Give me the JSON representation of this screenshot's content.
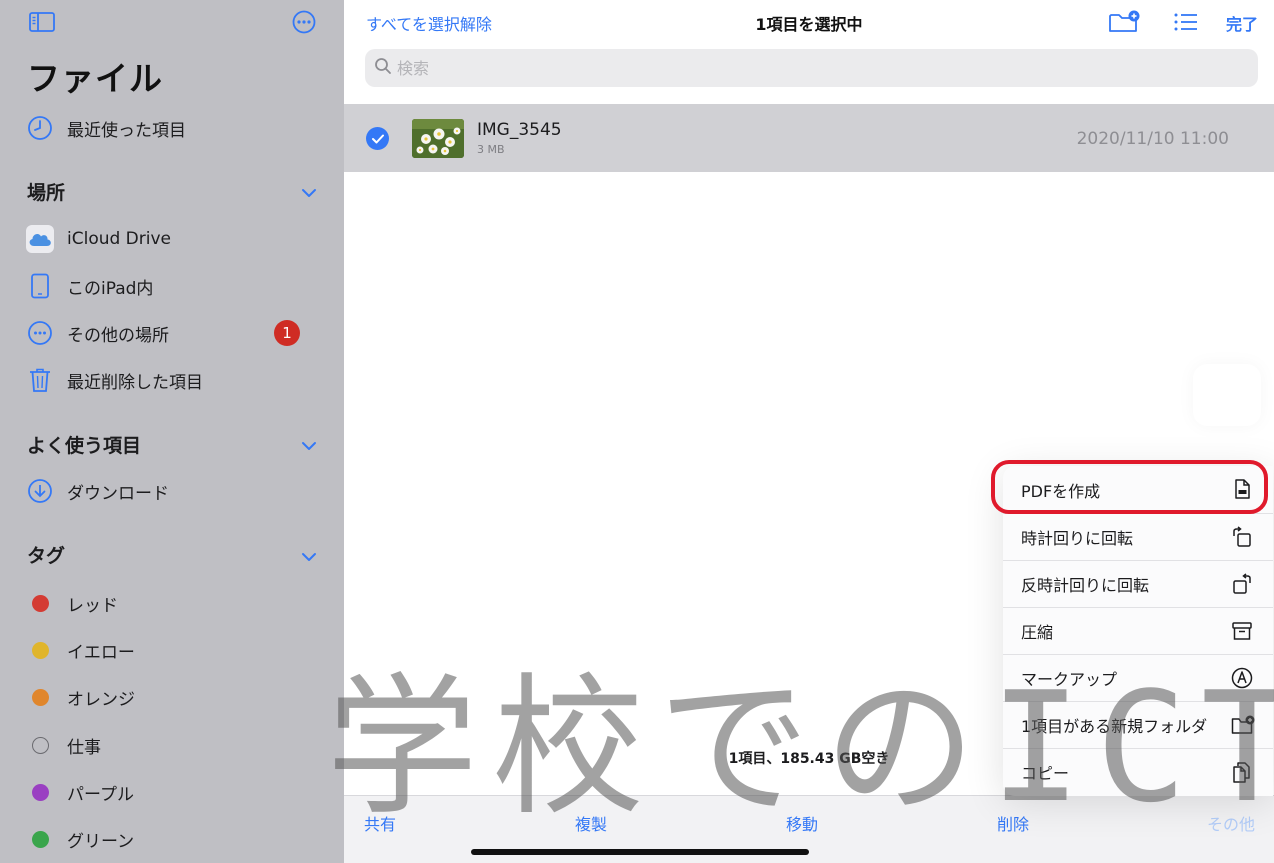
{
  "sidebar": {
    "title": "ファイル",
    "recents": "最近使った項目",
    "locations_header": "場所",
    "locations": [
      {
        "label": "iCloud Drive",
        "icon": "icloud-icon"
      },
      {
        "label": "このiPad内",
        "icon": "ipad-icon"
      },
      {
        "label": "その他の場所",
        "icon": "more-icon",
        "badge": "1"
      },
      {
        "label": "最近削除した項目",
        "icon": "trash-icon"
      }
    ],
    "favorites_header": "よく使う項目",
    "favorites": [
      {
        "label": "ダウンロード",
        "icon": "download-icon"
      }
    ],
    "tags_header": "タグ",
    "tags": [
      {
        "label": "レッド",
        "color": "#d43b33"
      },
      {
        "label": "イエロー",
        "color": "#e0b52c"
      },
      {
        "label": "オレンジ",
        "color": "#e0862c"
      },
      {
        "label": "仕事",
        "color": "none"
      },
      {
        "label": "パープル",
        "color": "#9a3fc2"
      },
      {
        "label": "グリーン",
        "color": "#3aa54c"
      }
    ]
  },
  "header": {
    "deselect_all": "すべてを選択解除",
    "title": "1項目を選択中",
    "done": "完了"
  },
  "search": {
    "placeholder": "検索"
  },
  "file": {
    "name": "IMG_3545",
    "size": "3 MB",
    "date": "2020/11/10 11:00"
  },
  "status": "1項目、185.43 GB空き",
  "toolbar": {
    "share": "共有",
    "duplicate": "複製",
    "move": "移動",
    "delete": "削除",
    "more": "その他"
  },
  "menu": [
    {
      "label": "PDFを作成",
      "icon": "pdf-document-icon"
    },
    {
      "label": "時計回りに回転",
      "icon": "rotate-clockwise-icon"
    },
    {
      "label": "反時計回りに回転",
      "icon": "rotate-counterclockwise-icon"
    },
    {
      "label": "圧縮",
      "icon": "archive-box-icon"
    },
    {
      "label": "マークアップ",
      "icon": "markup-pen-icon"
    },
    {
      "label": "1項目がある新規フォルダ",
      "icon": "new-folder-icon"
    },
    {
      "label": "コピー",
      "icon": "copy-icon"
    }
  ],
  "watermark": "学校でのICT",
  "colors": {
    "accent": "#3478f6",
    "badge": "#cf2c24",
    "highlight": "#e01a2c"
  }
}
